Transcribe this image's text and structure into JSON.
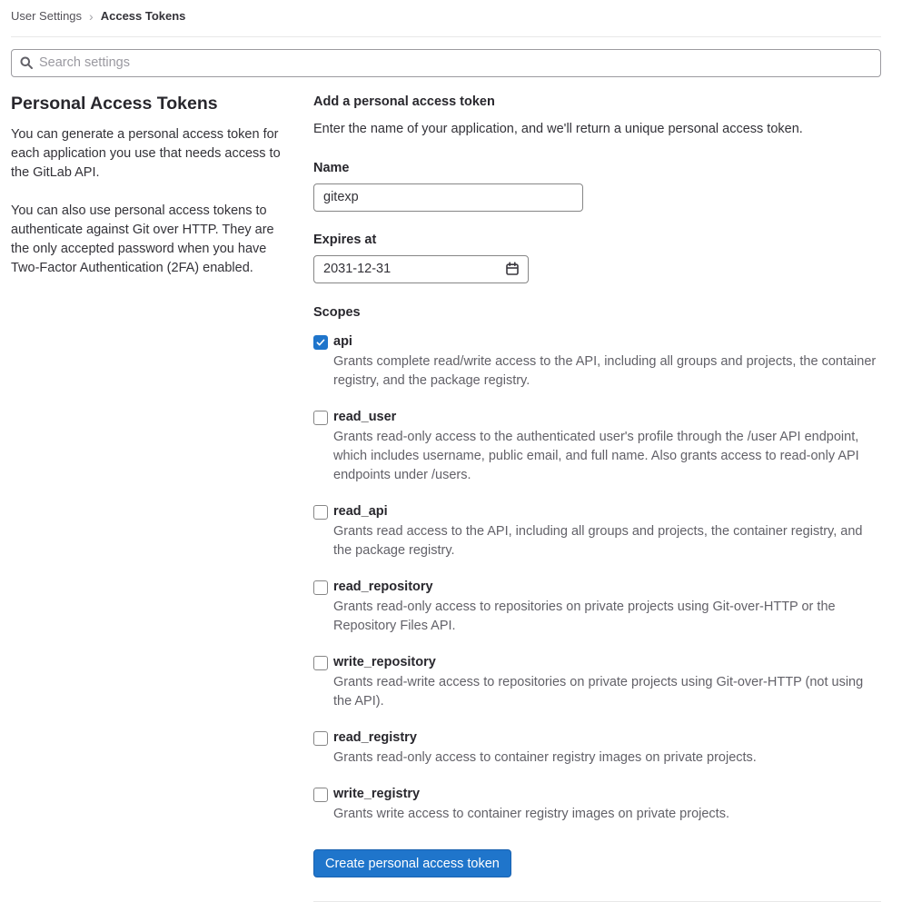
{
  "breadcrumb": {
    "parent": "User Settings",
    "separator": "›",
    "current": "Access Tokens"
  },
  "search": {
    "placeholder": "Search settings"
  },
  "sidebar": {
    "title": "Personal Access Tokens",
    "paragraphs": [
      "You can generate a personal access token for each application you use that needs access to the GitLab API.",
      "You can also use personal access tokens to authenticate against Git over HTTP. They are the only accepted password when you have Two-Factor Authentication (2FA) enabled."
    ]
  },
  "form": {
    "title": "Add a personal access token",
    "subtitle": "Enter the name of your application, and we'll return a unique personal access token.",
    "name_label": "Name",
    "name_value": "gitexp",
    "expires_label": "Expires at",
    "expires_value": "2031-12-31",
    "scopes_label": "Scopes",
    "scopes": [
      {
        "label": "api",
        "checked": true,
        "description": "Grants complete read/write access to the API, including all groups and projects, the container registry, and the package registry."
      },
      {
        "label": "read_user",
        "checked": false,
        "description": "Grants read-only access to the authenticated user's profile through the /user API endpoint, which includes username, public email, and full name. Also grants access to read-only API endpoints under /users."
      },
      {
        "label": "read_api",
        "checked": false,
        "description": "Grants read access to the API, including all groups and projects, the container registry, and the package registry."
      },
      {
        "label": "read_repository",
        "checked": false,
        "description": "Grants read-only access to repositories on private projects using Git-over-HTTP or the Repository Files API."
      },
      {
        "label": "write_repository",
        "checked": false,
        "description": "Grants read-write access to repositories on private projects using Git-over-HTTP (not using the API)."
      },
      {
        "label": "read_registry",
        "checked": false,
        "description": "Grants read-only access to container registry images on private projects."
      },
      {
        "label": "write_registry",
        "checked": false,
        "description": "Grants write access to container registry images on private projects."
      }
    ],
    "submit_label": "Create personal access token"
  },
  "colors": {
    "accent": "#1f75cb",
    "text_primary": "#333238",
    "text_secondary": "#626168",
    "divider": "#e8e8e8"
  }
}
